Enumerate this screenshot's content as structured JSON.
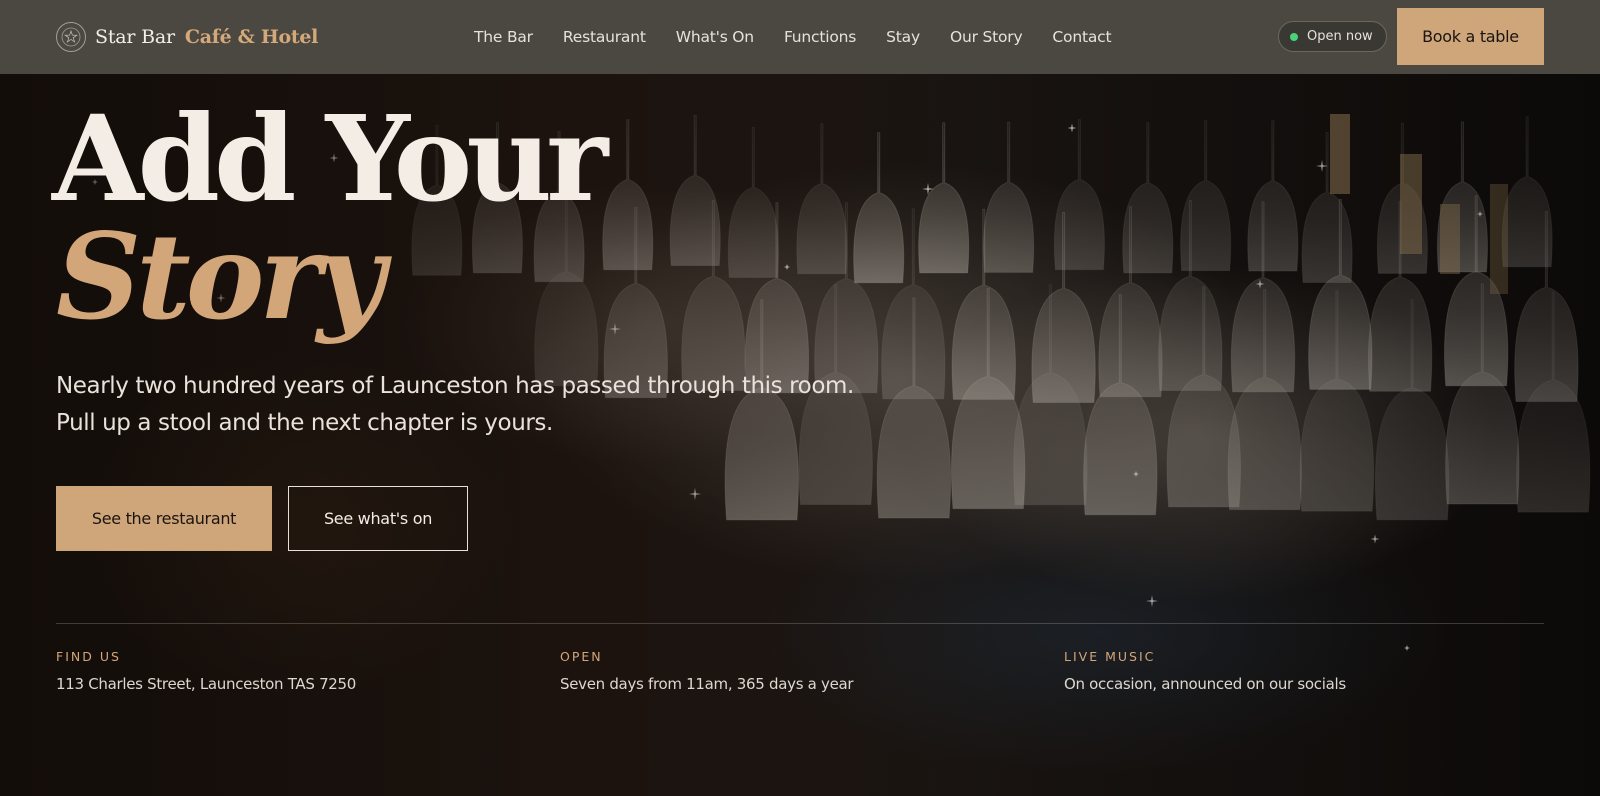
{
  "brand": {
    "name": "Star Bar",
    "sub": "Café & Hotel"
  },
  "nav": {
    "items": [
      "The Bar",
      "Restaurant",
      "What's On",
      "Functions",
      "Stay",
      "Our Story",
      "Contact"
    ]
  },
  "status": {
    "label": "Open now",
    "color": "#4bd37a"
  },
  "header_cta": "Book a table",
  "hero": {
    "headline_line1": "Add Your",
    "headline_line2": "Story",
    "intro_line1": "Nearly two hundred years of Launceston has passed through this room.",
    "intro_line2": "Pull up a stool and the next chapter is yours.",
    "primary_cta": "See the restaurant",
    "secondary_cta": "See what's on"
  },
  "info": [
    {
      "label": "FIND US",
      "value": "113 Charles Street, Launceston TAS 7250"
    },
    {
      "label": "OPEN",
      "value": "Seven days from 11am, 365 days a year"
    },
    {
      "label": "LIVE MUSIC",
      "value": "On occasion, announced on our socials"
    }
  ],
  "colors": {
    "accent": "#cfa57a",
    "header_bg": "#4b4842",
    "text": "#f3ede6"
  }
}
